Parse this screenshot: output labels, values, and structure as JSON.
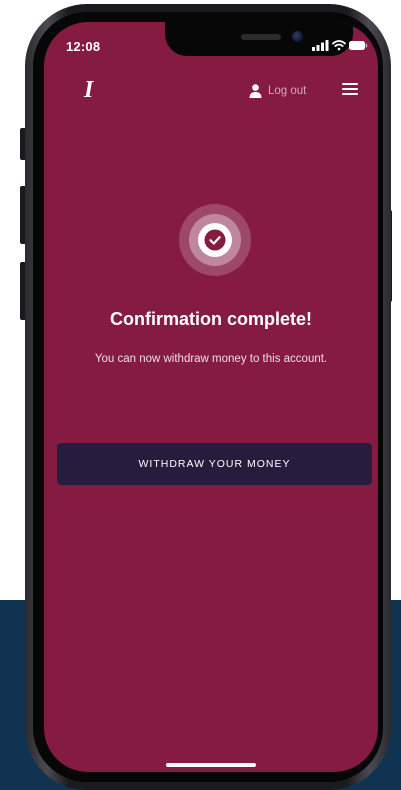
{
  "status_bar": {
    "time": "12:08",
    "icons": [
      "signal-icon",
      "wifi-icon",
      "battery-icon"
    ]
  },
  "header": {
    "logo_text": "I",
    "logout_label": "Log out",
    "logout_icon": "user-icon",
    "menu_icon": "hamburger-menu-icon"
  },
  "confirmation": {
    "icon": "check-circle-icon",
    "title": "Confirmation complete!",
    "message": "You can now withdraw money to this account."
  },
  "actions": {
    "withdraw_label": "WITHDRAW YOUR MONEY"
  },
  "colors": {
    "screen_background": "#851b40",
    "button_background": "#281c3e",
    "backdrop_panel": "#0f3350"
  }
}
